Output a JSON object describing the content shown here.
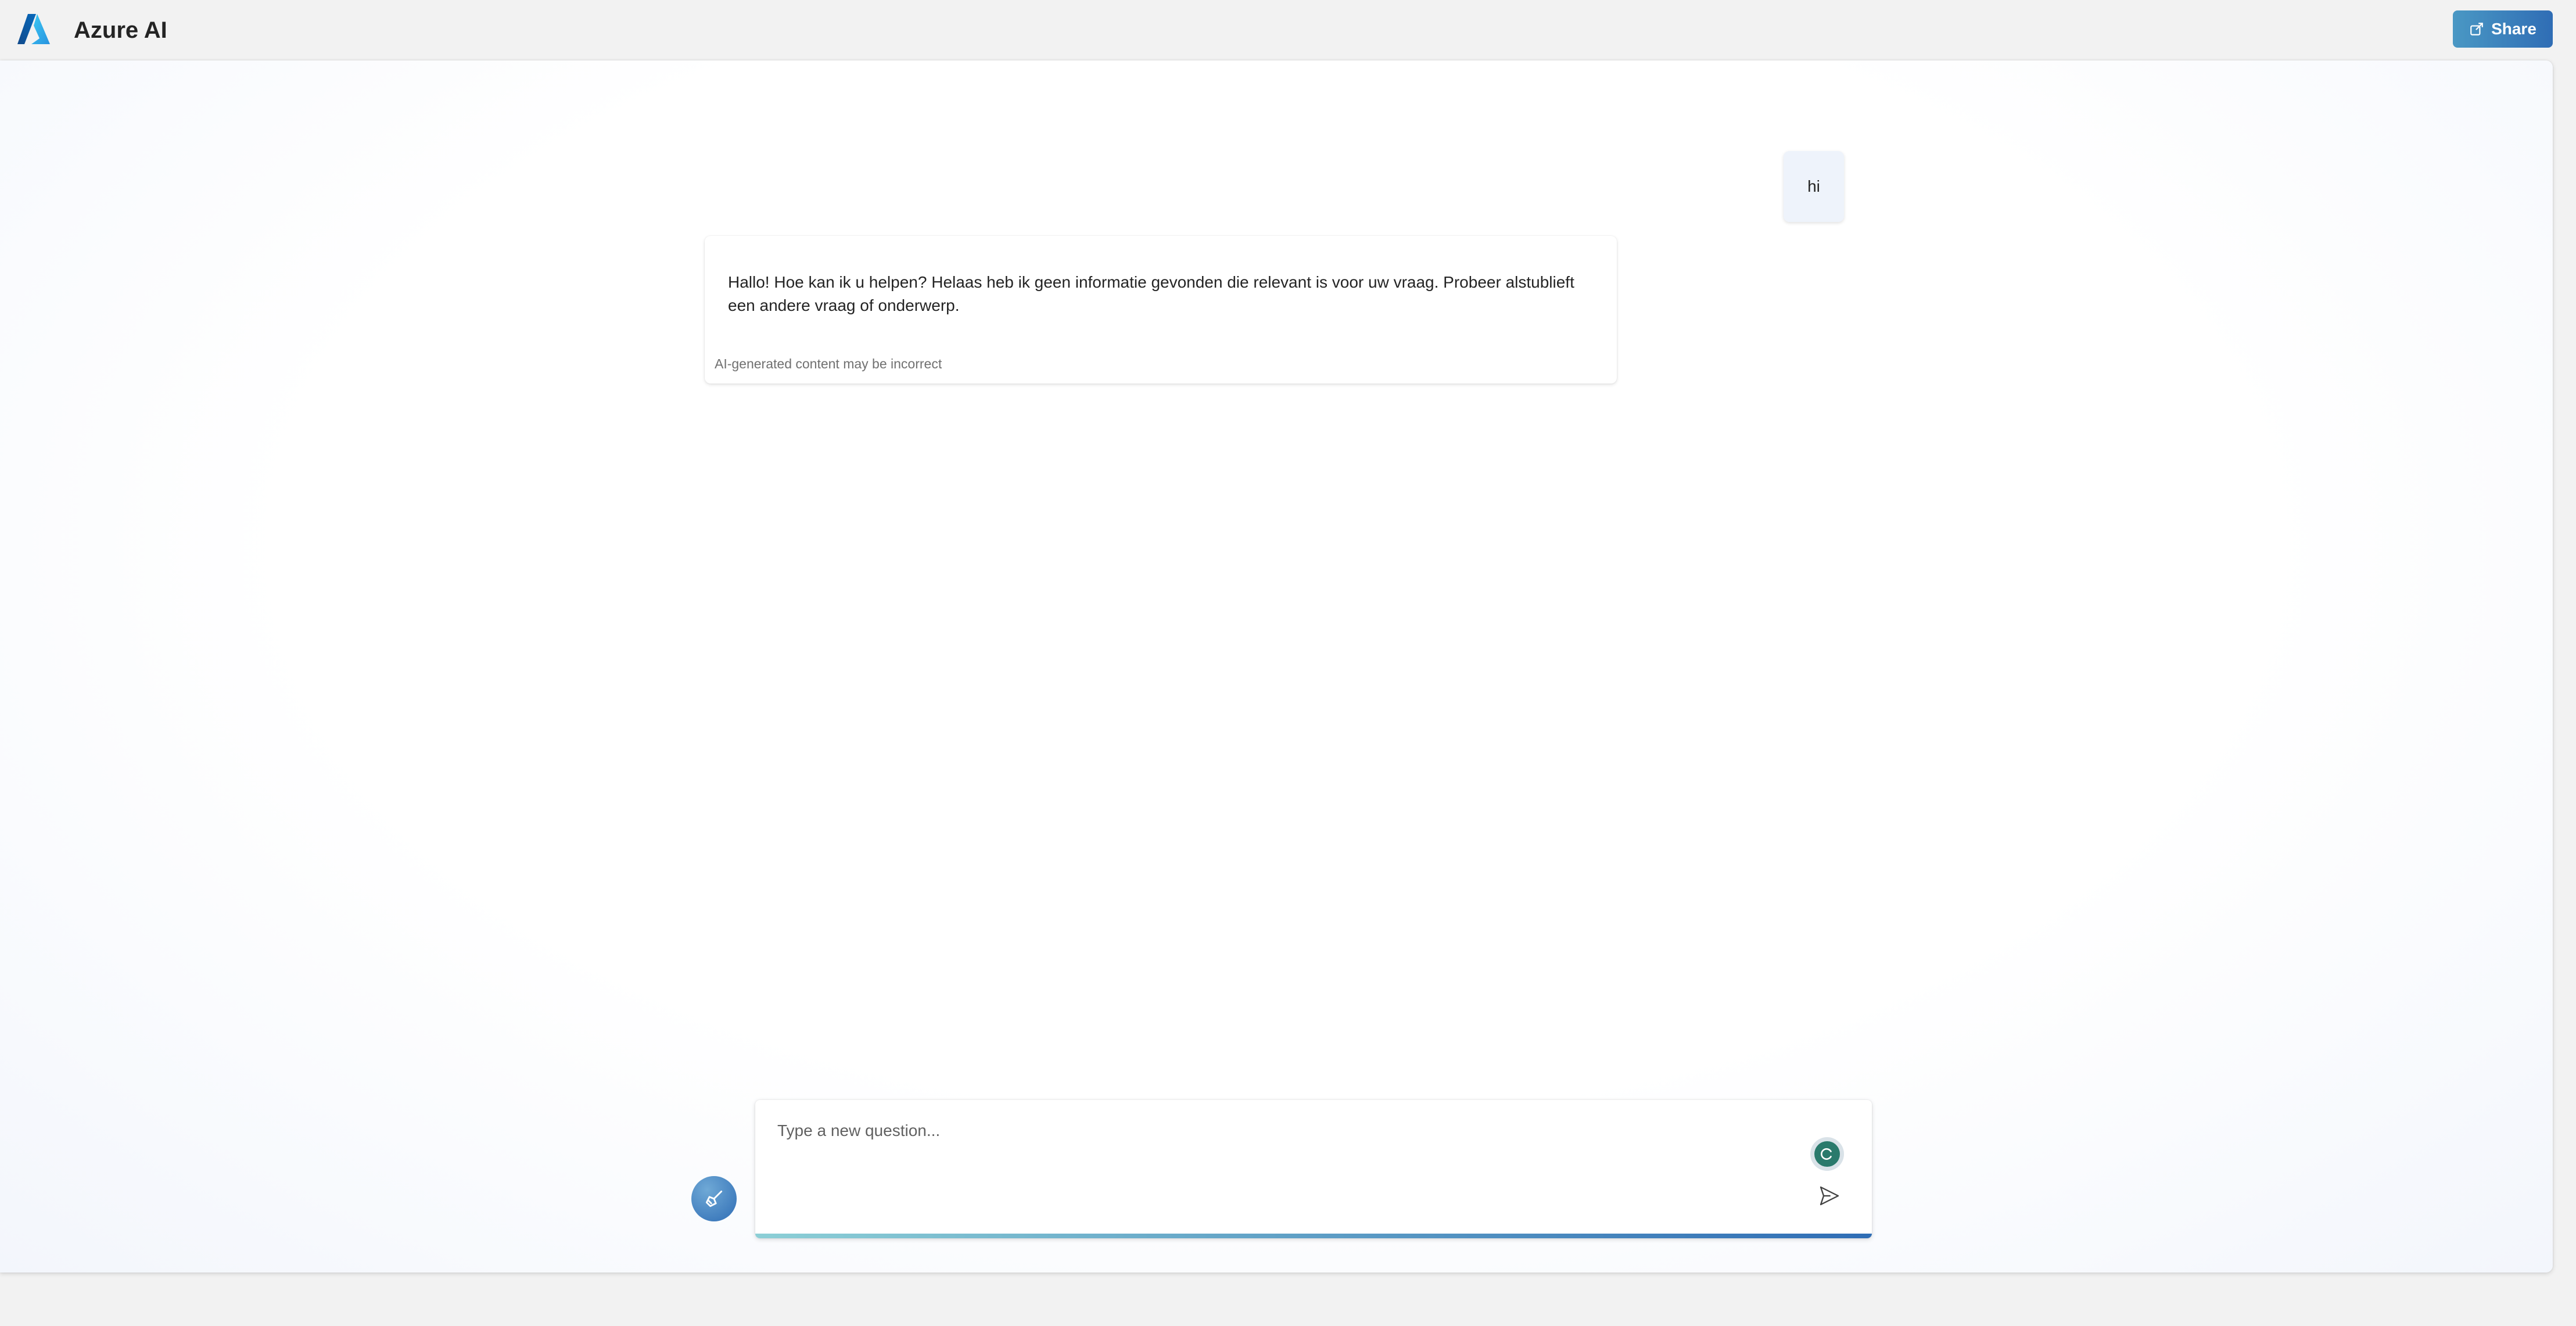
{
  "header": {
    "title": "Azure AI",
    "share_label": "Share"
  },
  "chat": {
    "user_message": "hi",
    "assistant_message": "Hallo! Hoe kan ik u helpen? Helaas heb ik geen informatie gevonden die relevant is voor uw vraag. Probeer alstublieft een andere vraag of onderwerp.",
    "disclaimer": "AI-generated content may be incorrect"
  },
  "composer": {
    "placeholder": "Type a new question...",
    "value": ""
  },
  "icons": {
    "logo": "azure-logo-icon",
    "share": "share-icon",
    "clear": "broom-icon",
    "assistant": "assistant-status-icon",
    "send": "send-icon"
  },
  "colors": {
    "accent": "#2f6db5",
    "accent_light": "#4a98c4",
    "user_bubble": "#eef3fb",
    "assistant_status": "#2a7a6c"
  }
}
